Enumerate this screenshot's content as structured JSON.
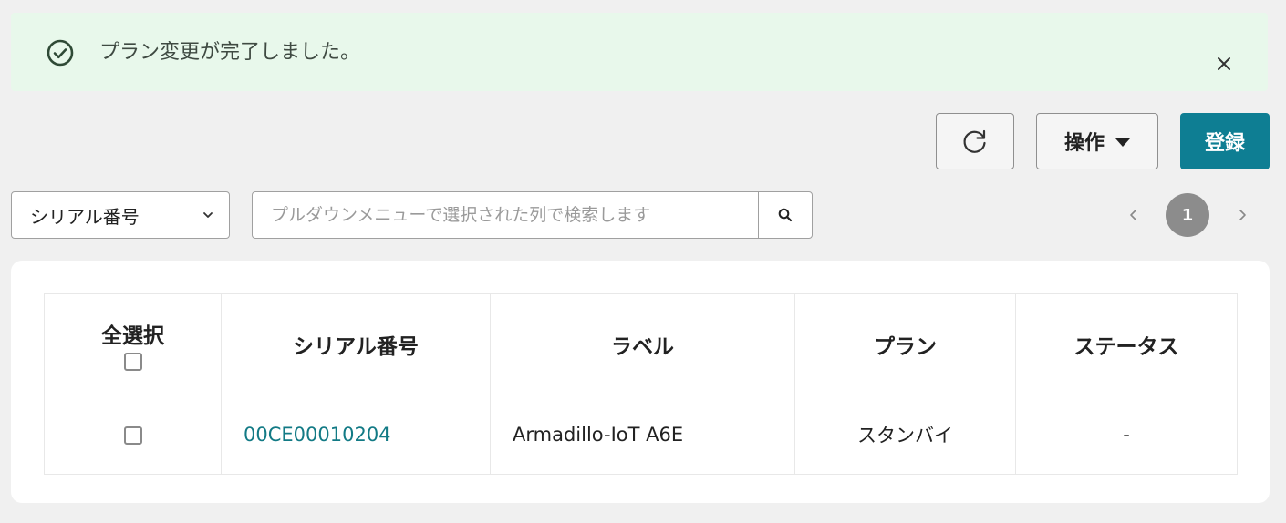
{
  "alert": {
    "message": "プラン変更が完了しました。",
    "icon": "check-circle-icon",
    "close_icon": "close-icon"
  },
  "toolbar": {
    "refresh_icon": "refresh-icon",
    "operations_label": "操作",
    "register_label": "登録"
  },
  "filter": {
    "selected_field": "シリアル番号",
    "search_placeholder": "プルダウンメニューで選択された列で検索します",
    "search_value": ""
  },
  "pagination": {
    "current_page": "1"
  },
  "table": {
    "select_all_label": "全選択",
    "headers": [
      "シリアル番号",
      "ラベル",
      "プラン",
      "ステータス"
    ],
    "rows": [
      {
        "serial": "00CE00010204",
        "label": "Armadillo-IoT A6E",
        "plan": "スタンバイ",
        "status": "-"
      }
    ]
  },
  "colors": {
    "alert_bg": "#e8f8eb",
    "primary": "#0e7e93",
    "link": "#127a85"
  }
}
